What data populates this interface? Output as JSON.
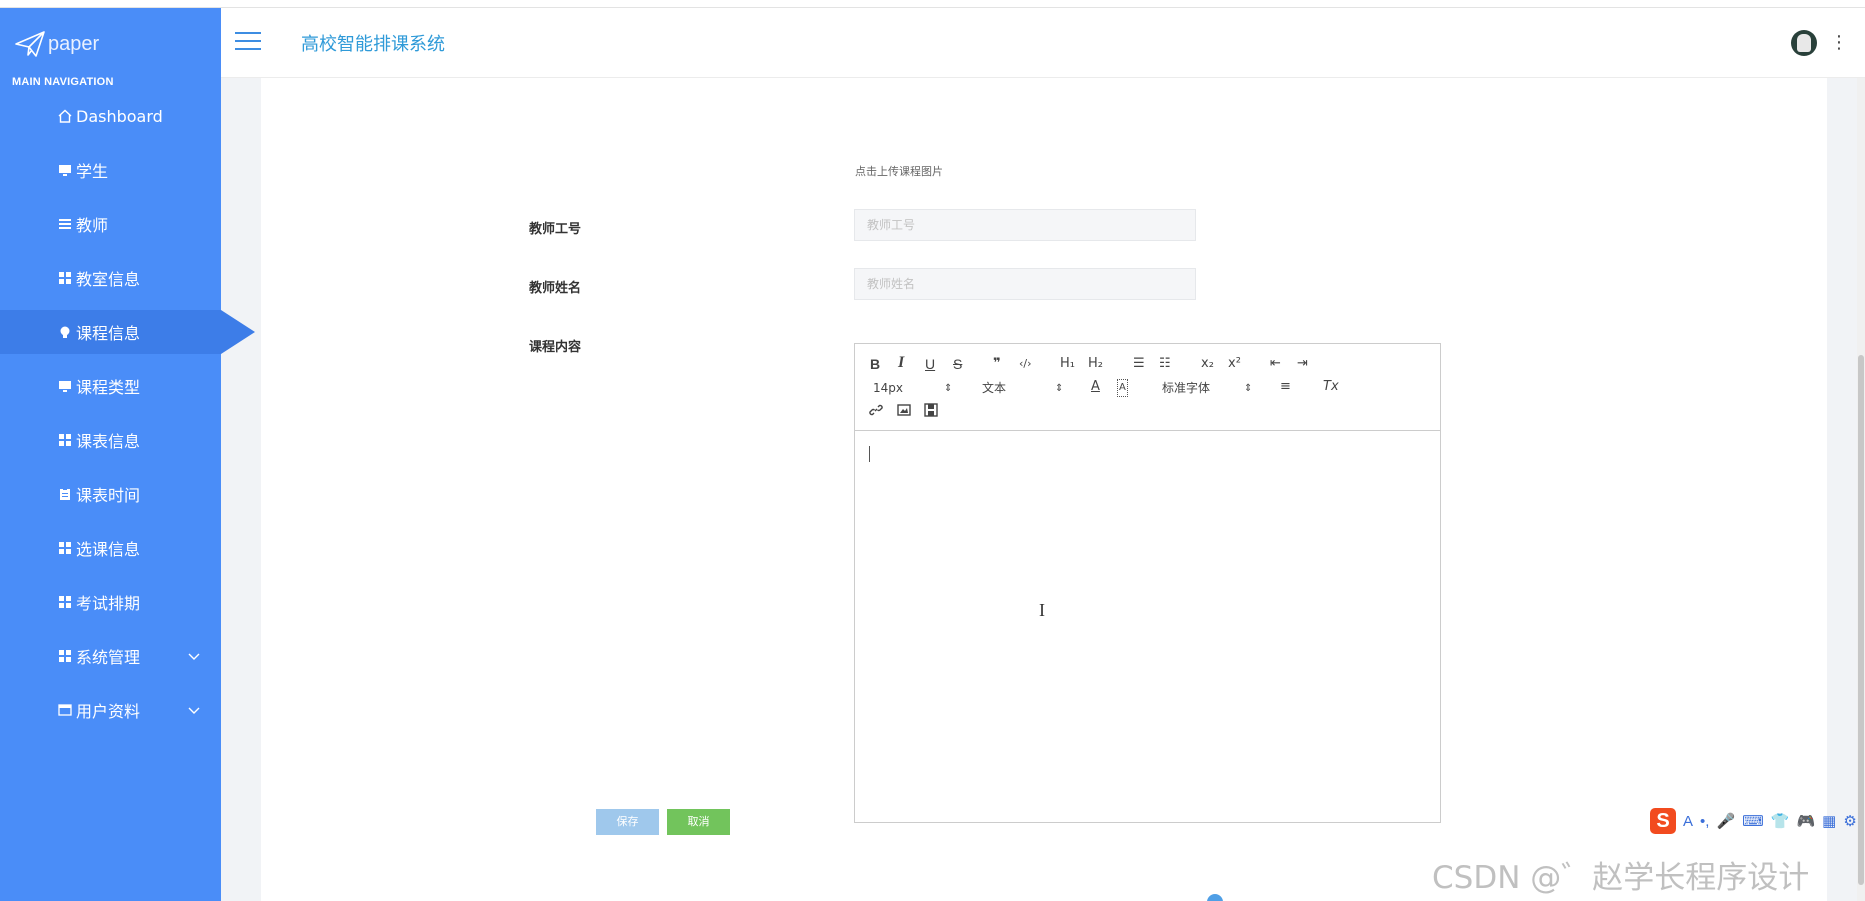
{
  "logo": {
    "text": "paper"
  },
  "nav": {
    "heading": "MAIN NAVIGATION",
    "items": [
      {
        "label": "Dashboard",
        "icon": "home-icon"
      },
      {
        "label": "学生",
        "icon": "monitor-icon"
      },
      {
        "label": "教师",
        "icon": "list-icon"
      },
      {
        "label": "教室信息",
        "icon": "grid-icon"
      },
      {
        "label": "课程信息",
        "icon": "lightbulb-icon",
        "active": true
      },
      {
        "label": "课程类型",
        "icon": "monitor-icon"
      },
      {
        "label": "课表信息",
        "icon": "grid-icon"
      },
      {
        "label": "课表时间",
        "icon": "clipboard-icon"
      },
      {
        "label": "选课信息",
        "icon": "grid-icon"
      },
      {
        "label": "考试排期",
        "icon": "grid-icon"
      },
      {
        "label": "系统管理",
        "icon": "grid-icon",
        "expandable": true
      },
      {
        "label": "用户资料",
        "icon": "window-icon",
        "expandable": true
      }
    ]
  },
  "header": {
    "title": "高校智能排课系统"
  },
  "form": {
    "upload_hint": "点击上传课程图片",
    "teacher_id": {
      "label": "教师工号",
      "placeholder": "教师工号"
    },
    "teacher_name": {
      "label": "教师姓名",
      "placeholder": "教师姓名"
    },
    "content": {
      "label": "课程内容"
    }
  },
  "editor": {
    "bold": "B",
    "italic": "I",
    "underline": "U",
    "strike": "S",
    "quote": "❞",
    "code": "‹/›",
    "h1": "H₁",
    "h2": "H₂",
    "ordered_list": "☰",
    "bullet_list": "☷",
    "subscript": "x₂",
    "superscript": "x²",
    "outdent": "⇤",
    "indent": "⇥",
    "size_value": "14px",
    "text_value": "文本",
    "font_color": "A",
    "bg_color": "A",
    "font_value": "标准字体",
    "align": "≡",
    "clear": "Tx",
    "select_arrow": "⇕"
  },
  "buttons": {
    "save": "保存",
    "cancel": "取消"
  },
  "watermark": "CSDN @゛赵学长程序设计",
  "ime": {
    "logo": "S",
    "items": [
      "A",
      "•,",
      "🎤",
      "⌨",
      "👕",
      "🎮",
      "▦",
      "⚙"
    ]
  },
  "colors": {
    "sidebar": "#4a8df8",
    "active": "#3d7de8",
    "title": "#2f9ad8",
    "save": "#9fc8ec",
    "cancel": "#72c45c"
  }
}
